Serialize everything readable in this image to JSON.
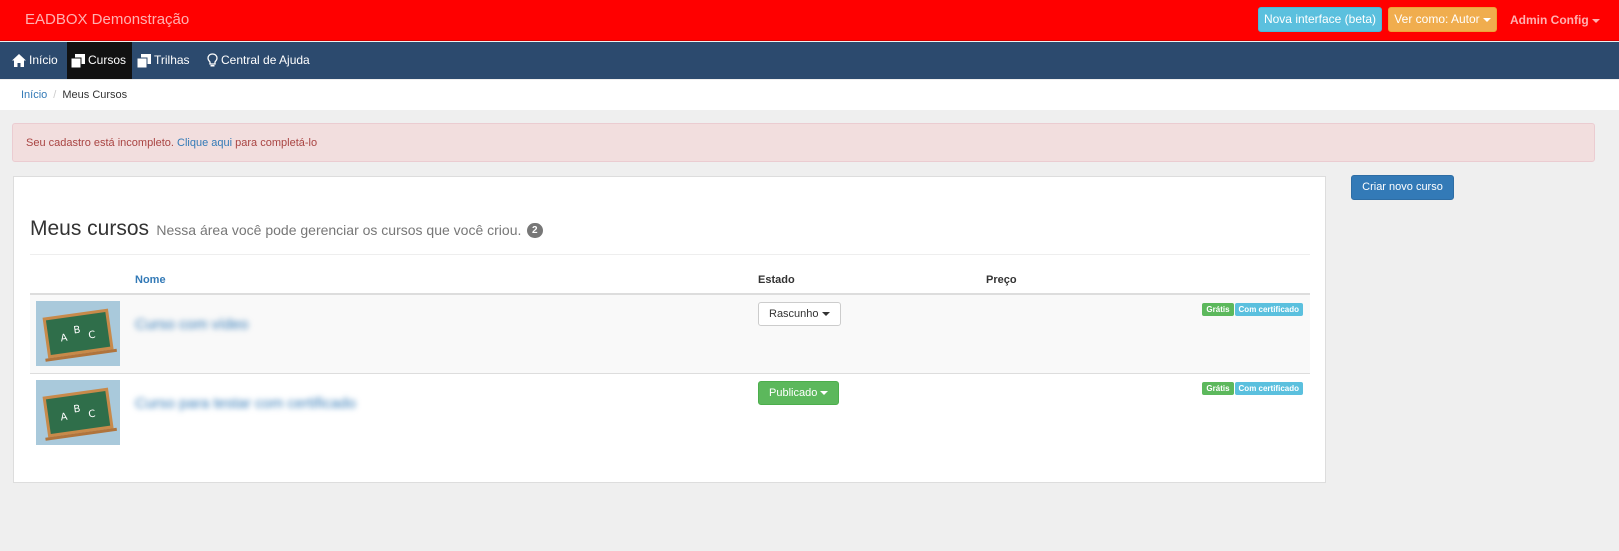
{
  "topbar": {
    "brand": "EADBOX Demonstração",
    "beta_button": "Nova interface (beta)",
    "view_as_button": "Ver como: Autor",
    "admin_menu": "Admin Config"
  },
  "nav": {
    "items": [
      {
        "label": "Início",
        "icon": "home-icon"
      },
      {
        "label": "Cursos",
        "icon": "copy-icon"
      },
      {
        "label": "Trilhas",
        "icon": "copy-icon"
      },
      {
        "label": "Central de Ajuda",
        "icon": "lightbulb-icon"
      }
    ],
    "active": "Cursos"
  },
  "breadcrumb": {
    "home": "Início",
    "separator": "/",
    "current": "Meus Cursos"
  },
  "alert": {
    "text_before": "Seu cadastro está incompleto.",
    "link": "Clique aqui",
    "text_after": "para completá-lo"
  },
  "main": {
    "title": "Meus cursos",
    "subtitle": "Nessa área você pode gerenciar os cursos que você criou.",
    "count": "2",
    "create_button": "Criar novo curso",
    "table": {
      "columns": [
        "",
        "Nome",
        "Estado",
        "Preço"
      ],
      "rows": [
        {
          "name": "Curso com vídeo",
          "state": "Rascunho",
          "price": "",
          "labels": [
            "Grátis",
            "Com certificado"
          ]
        },
        {
          "name": "Curso para testar com certificado",
          "state": "Publicado",
          "price": "",
          "labels": [
            "Grátis",
            "Com certificado"
          ]
        }
      ]
    }
  },
  "thumbnail": {
    "letters": [
      "A",
      "B",
      "C"
    ]
  },
  "colors": {
    "topbar": "#ff0000",
    "navbar": "#2c4a6e",
    "primary": "#337ab7",
    "success": "#5cb85c",
    "info": "#5bc0de",
    "warning": "#f0ad4e",
    "danger_bg": "#f2dede"
  }
}
